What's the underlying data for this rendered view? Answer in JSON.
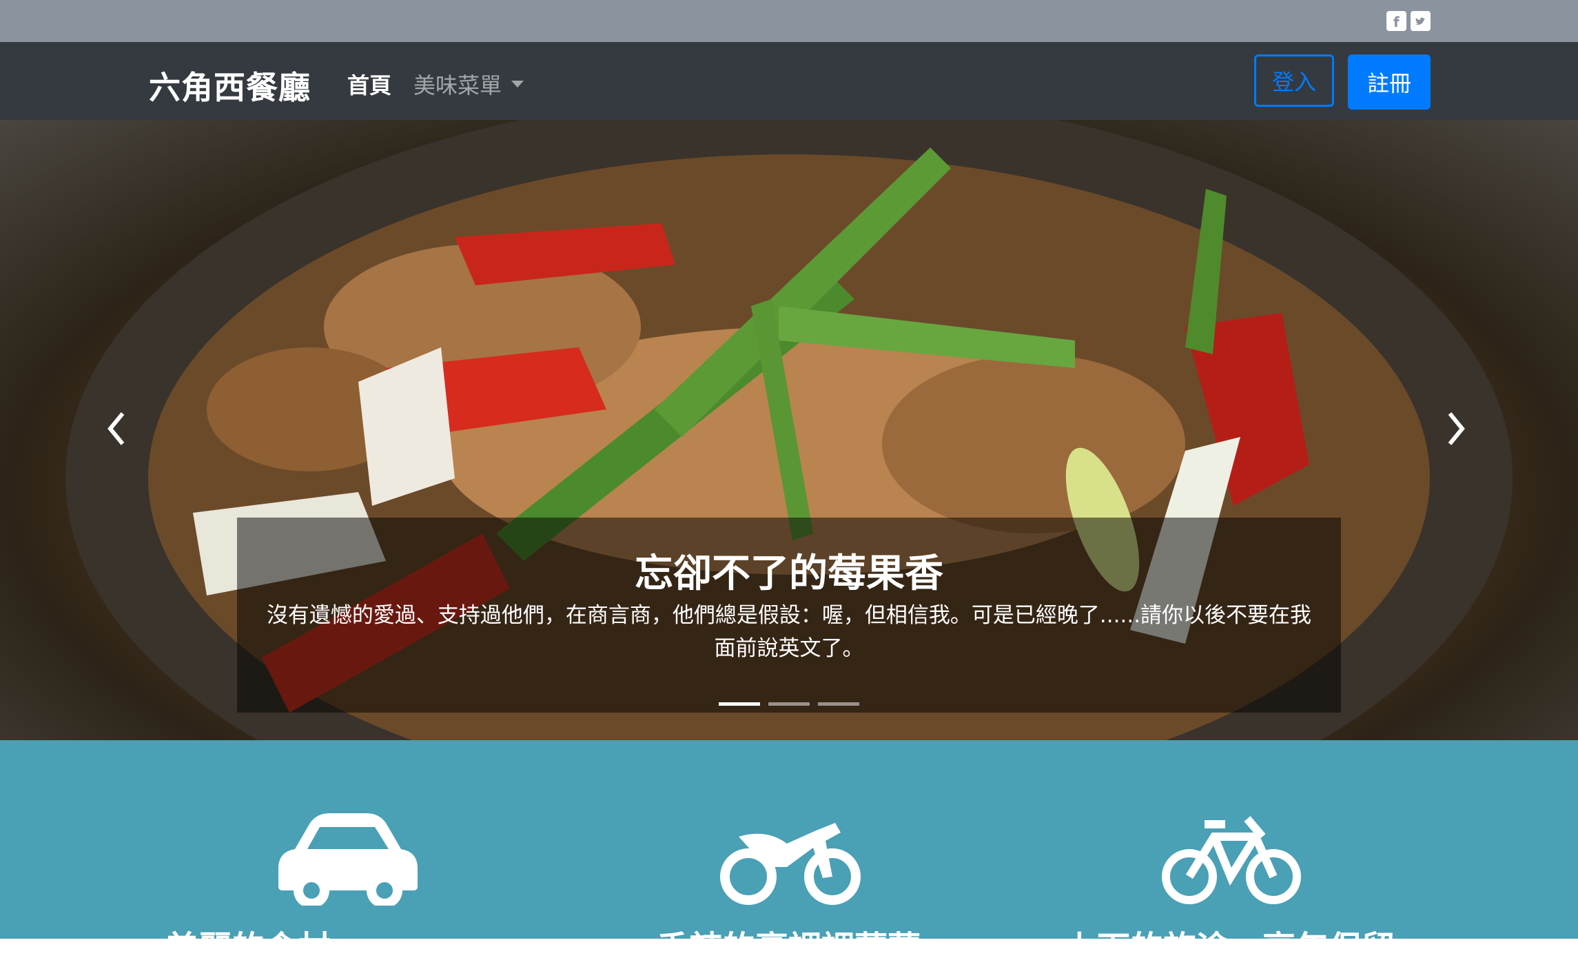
{
  "topbar": {
    "social": [
      "facebook-icon",
      "twitter-icon"
    ]
  },
  "nav": {
    "brand": "六角西餐廳",
    "home": "首頁",
    "menu": "美味菜單",
    "login": "登入",
    "signup": "註冊"
  },
  "carousel": {
    "title": "忘卻不了的莓果香",
    "text": "沒有遺憾的愛過、支持過他們，在商言商，他們總是假設：喔，但相信我。可是已經晚了......請你以後不要在我面前說英文了。",
    "indicators": 3,
    "active_index": 0
  },
  "features": [
    {
      "icon": "car-icon",
      "label": "美麗的食材"
    },
    {
      "icon": "motorcycle-icon",
      "label": "香辣的烹調調薑薑"
    },
    {
      "icon": "bicycle-icon",
      "label": "上下的旅途，享年保留"
    }
  ],
  "colors": {
    "topbar": "#8a939e",
    "navbar": "#343a40",
    "primary": "#007bff",
    "features_bg": "#4aa0b5"
  }
}
